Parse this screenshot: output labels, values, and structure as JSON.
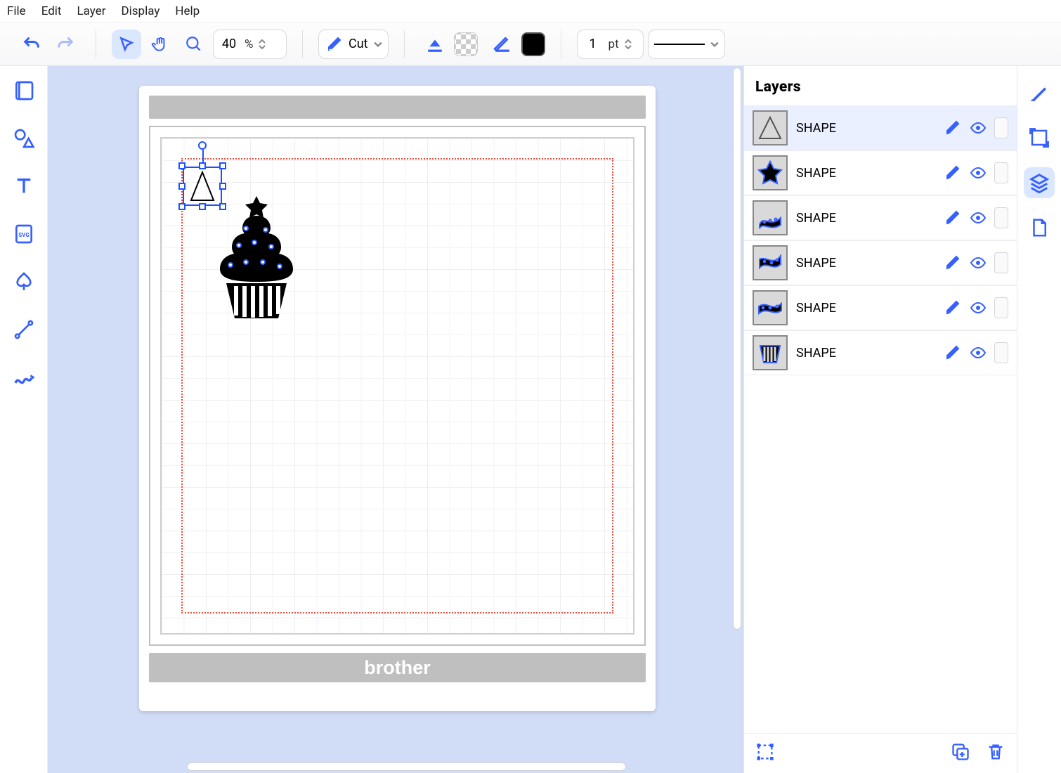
{
  "menu": {
    "file": "File",
    "edit": "Edit",
    "layer": "Layer",
    "display": "Display",
    "help": "Help"
  },
  "toolbar": {
    "zoom": {
      "value": "40",
      "unit": "%"
    },
    "cut": {
      "label": "Cut"
    },
    "stroke": {
      "value": "1",
      "unit": "pt"
    },
    "fill_color": "#3560ff",
    "swatch_color": "#000000"
  },
  "panels": {
    "layers_title": "Layers"
  },
  "layers": [
    {
      "name": "SHAPE",
      "selected": true
    },
    {
      "name": "SHAPE"
    },
    {
      "name": "SHAPE"
    },
    {
      "name": "SHAPE"
    },
    {
      "name": "SHAPE"
    },
    {
      "name": "SHAPE"
    }
  ],
  "canvas": {
    "brand": "brother"
  }
}
